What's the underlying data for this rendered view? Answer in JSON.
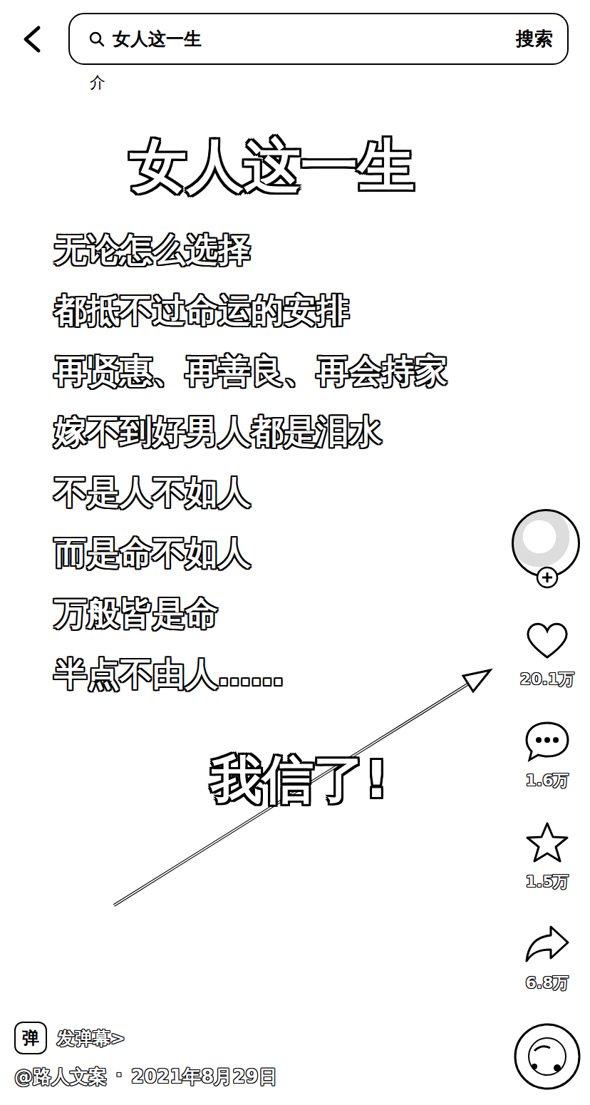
{
  "search": {
    "query": "女人这一生",
    "button": "搜索"
  },
  "fragment": "介",
  "caption": {
    "title": "女人这一生",
    "lines": [
      "无论怎么选择",
      "都抵不过命运的安排",
      "再贤惠、再善良、再会持家",
      "嫁不到好男人都是泪水",
      "不是人不如人",
      "而是命不如人",
      "万般皆是命",
      "半点不由人……"
    ],
    "reaction": "我信了!"
  },
  "actions": [
    {
      "kind": "like",
      "count": "20.1万"
    },
    {
      "kind": "comment",
      "count": "1.6万"
    },
    {
      "kind": "favorite",
      "count": "1.5万"
    },
    {
      "kind": "share",
      "count": "6.8万"
    }
  ],
  "danmaku": {
    "badge": "弹",
    "label": "发弹幕>"
  },
  "author": {
    "handle": "@路人文案",
    "separator": "·",
    "date": "2021年8月29日"
  }
}
